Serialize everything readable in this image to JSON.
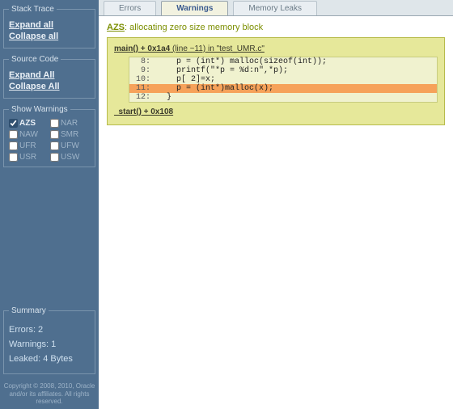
{
  "sidebar": {
    "stack_trace": {
      "legend": "Stack Trace",
      "expand": "Expand all",
      "collapse": "Collapse all"
    },
    "source_code": {
      "legend": "Source Code",
      "expand": "Expand All",
      "collapse": "Collapse All"
    },
    "show_warnings": {
      "legend": "Show Warnings",
      "opts": [
        {
          "label": "AZS",
          "checked": true
        },
        {
          "label": "NAR",
          "checked": false
        },
        {
          "label": "NAW",
          "checked": false
        },
        {
          "label": "SMR",
          "checked": false
        },
        {
          "label": "UFR",
          "checked": false
        },
        {
          "label": "UFW",
          "checked": false
        },
        {
          "label": "USR",
          "checked": false
        },
        {
          "label": "USW",
          "checked": false
        }
      ]
    },
    "summary": {
      "legend": "Summary",
      "errors": "Errors: 2",
      "warnings": "Warnings: 1",
      "leaked": "Leaked: 4 Bytes"
    },
    "copyright": "Copyright © 2008, 2010, Oracle and/or its affiliates. All rights reserved."
  },
  "tabs": {
    "errors": "Errors",
    "warnings": "Warnings",
    "leaks": "Memory Leaks"
  },
  "warning": {
    "tag": "AZS",
    "desc": ": allocating zero size memory block",
    "frame1_fun": "main() + 0x1a4",
    "frame1_loc": " (line ~11) in \"test_UMR.c\"",
    "code": [
      {
        "ln": "8:",
        "txt": "    p = (int*) malloc(sizeof(int));"
      },
      {
        "ln": "9:",
        "txt": "    printf(\"*p = %d:n\",*p);"
      },
      {
        "ln": "10:",
        "txt": "    p[ 2]=x;"
      },
      {
        "ln": "11:",
        "txt": "    p = (int*)malloc(x);",
        "hl": true
      },
      {
        "ln": "12:",
        "txt": "  }"
      }
    ],
    "frame2": "_start() + 0x108"
  }
}
